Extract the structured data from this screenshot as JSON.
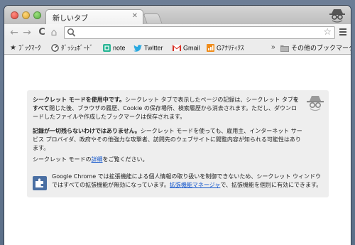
{
  "tab": {
    "title": "新しいタブ",
    "close_glyph": "✕"
  },
  "toolbar": {
    "back_glyph": "←",
    "forward_glyph": "→",
    "reload_glyph": "C",
    "home_glyph": "⌂",
    "omnibox_value": "",
    "star_glyph": "☆"
  },
  "bookmarks": {
    "items": [
      {
        "label": "ﾌﾞｯｸﾏｰｸ",
        "icon": "star-icon"
      },
      {
        "label": "ﾀﾞｯｼｭﾎﾞｰﾄﾞ",
        "icon": "gauge-icon"
      },
      {
        "label": "note",
        "icon": "note-icon"
      },
      {
        "label": "Twitter",
        "icon": "twitter-bird-icon"
      },
      {
        "label": "Gmail",
        "icon": "gmail-icon"
      },
      {
        "label": "Gｱﾅﾘﾃｨｸｽ",
        "icon": "analytics-icon"
      }
    ],
    "overflow_glyph": "»",
    "other": {
      "label": "その他のブックマーク",
      "icon": "folder-icon"
    }
  },
  "incognito": {
    "p1": {
      "b1": "シークレット モードを使用中です。",
      "t1": "シークレット タブで表示したページの記録は、シークレット タブ",
      "b2": "をすべて",
      "t2": "閉じた後、ブラウザの履歴、Cookie の保存場所、検索履歴から消去されます。ただし、ダウンロードしたファイルや作成したブックマークは保存されます。"
    },
    "p2": {
      "b1": "記録が一切残らないわけではありません。",
      "t1": "シークレット モードを使っても、雇用主、インターネット サービス プロバイダ、政府やその他強力な攻撃者、訪問先のウェブサイトに閲覧内容が知られる可能性はあります。"
    },
    "p3": {
      "t1": "シークレット モードの",
      "link": "詳細",
      "t2": "をご覧ください。"
    },
    "p4": {
      "t1": "Google Chrome では拡張機能による個人情報の取り扱いを制御できないため、シークレット ウィンドウではすべての拡張機能が無効になっています。",
      "link": "拡張機能マネージャ",
      "t2": "で、拡張機能を個別に有効にできます。"
    }
  },
  "colors": {
    "link": "#1155cc",
    "panel": "#eeeeee",
    "desktop": "#5c7089"
  }
}
